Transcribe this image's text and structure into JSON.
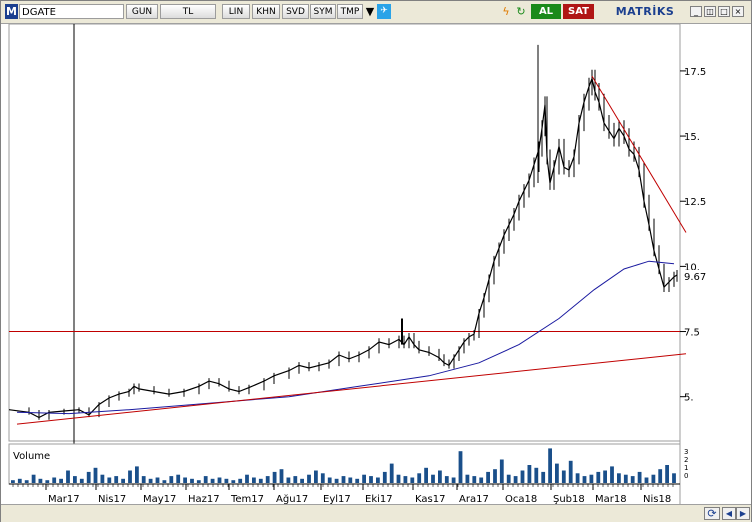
{
  "toolbar": {
    "logo": "M",
    "symbol": "DGATE",
    "period": "GUN",
    "currency": "TL",
    "buttons": [
      "LIN",
      "KHN",
      "SVD",
      "SYM",
      "TMP"
    ],
    "buy_label": "AL",
    "sell_label": "SAT",
    "brand": "MATRİKS",
    "minimize": "_",
    "restore": "◫",
    "maximize": "□",
    "close": "×"
  },
  "volume": {
    "label": "Volume",
    "mini_labels": [
      "3",
      "2",
      "1",
      "0"
    ]
  },
  "chart_data": {
    "type": "candlestick",
    "title": "",
    "ylim": [
      3.3,
      19.3
    ],
    "y_ticks": [
      "17.5",
      "15.",
      "12.5",
      "10.",
      "7.5",
      "5."
    ],
    "last_price_label": "9.67",
    "x_ticks": [
      "Mar17",
      "Nis17",
      "May17",
      "Haz17",
      "Tem17",
      "Ağu17",
      "Eyl17",
      "Eki17",
      "Kas17",
      "Ara17",
      "Oca18",
      "Şub18",
      "Mar18",
      "Nis18"
    ],
    "horizontal_line": 7.5,
    "series": [
      {
        "name": "",
        "points": [
          [
            0,
            4.5
          ],
          [
            20,
            4.4
          ],
          [
            30,
            4.2
          ],
          [
            40,
            4.4
          ],
          [
            55,
            4.45
          ],
          [
            70,
            4.5
          ],
          [
            80,
            4.3
          ],
          [
            90,
            4.7
          ],
          [
            100,
            4.95
          ],
          [
            110,
            5.1
          ],
          [
            120,
            5.2
          ],
          [
            125,
            5.4
          ],
          [
            130,
            5.3
          ],
          [
            145,
            5.2
          ],
          [
            160,
            5.1
          ],
          [
            175,
            5.2
          ],
          [
            190,
            5.4
          ],
          [
            200,
            5.6
          ],
          [
            210,
            5.5
          ],
          [
            220,
            5.3
          ],
          [
            230,
            5.2
          ],
          [
            240,
            5.35
          ],
          [
            255,
            5.6
          ],
          [
            265,
            5.8
          ],
          [
            280,
            6.0
          ],
          [
            290,
            6.2
          ],
          [
            300,
            6.1
          ],
          [
            310,
            6.2
          ],
          [
            320,
            6.3
          ],
          [
            330,
            6.6
          ],
          [
            340,
            6.45
          ],
          [
            350,
            6.6
          ],
          [
            360,
            6.8
          ],
          [
            370,
            7.1
          ],
          [
            380,
            7.0
          ],
          [
            390,
            7.2
          ],
          [
            395,
            7.0
          ],
          [
            400,
            7.3
          ],
          [
            405,
            7.0
          ],
          [
            410,
            6.8
          ],
          [
            420,
            6.7
          ],
          [
            430,
            6.5
          ],
          [
            435,
            6.3
          ],
          [
            440,
            6.2
          ],
          [
            445,
            6.5
          ],
          [
            450,
            6.8
          ],
          [
            455,
            7.1
          ],
          [
            460,
            7.3
          ],
          [
            465,
            7.4
          ],
          [
            470,
            8.2
          ],
          [
            475,
            8.8
          ],
          [
            480,
            9.5
          ],
          [
            485,
            10.2
          ],
          [
            490,
            10.7
          ],
          [
            495,
            11.2
          ],
          [
            500,
            11.6
          ],
          [
            505,
            12.0
          ],
          [
            510,
            12.5
          ],
          [
            515,
            12.9
          ],
          [
            520,
            13.3
          ],
          [
            525,
            13.9
          ],
          [
            530,
            14.5
          ],
          [
            533,
            15.3
          ],
          [
            536,
            16.2
          ],
          [
            538,
            14.2
          ],
          [
            541,
            13.2
          ],
          [
            545,
            13.8
          ],
          [
            550,
            14.6
          ],
          [
            555,
            13.8
          ],
          [
            560,
            13.7
          ],
          [
            565,
            14.2
          ],
          [
            570,
            15.5
          ],
          [
            575,
            16.3
          ],
          [
            580,
            16.9
          ],
          [
            583,
            17.2
          ],
          [
            586,
            16.7
          ],
          [
            590,
            16.3
          ],
          [
            595,
            15.5
          ],
          [
            600,
            15.2
          ],
          [
            605,
            14.9
          ],
          [
            610,
            15.3
          ],
          [
            615,
            15.0
          ],
          [
            620,
            14.5
          ],
          [
            625,
            14.3
          ],
          [
            630,
            13.7
          ],
          [
            635,
            12.5
          ],
          [
            640,
            11.6
          ],
          [
            645,
            10.6
          ],
          [
            650,
            9.9
          ],
          [
            655,
            9.2
          ],
          [
            660,
            9.4
          ],
          [
            665,
            9.6
          ],
          [
            668,
            9.67
          ]
        ]
      },
      {
        "name": "",
        "points": [
          [
            8,
            4.4
          ],
          [
            60,
            4.35
          ],
          [
            120,
            4.5
          ],
          [
            200,
            4.75
          ],
          [
            280,
            5.0
          ],
          [
            350,
            5.4
          ],
          [
            420,
            5.8
          ],
          [
            470,
            6.3
          ],
          [
            510,
            7.0
          ],
          [
            550,
            8.0
          ],
          [
            585,
            9.1
          ],
          [
            615,
            9.9
          ],
          [
            640,
            10.2
          ],
          [
            665,
            10.1
          ]
        ]
      },
      {
        "name": "",
        "points": [
          [
            8,
            3.95
          ],
          [
            677,
            6.65
          ]
        ]
      },
      {
        "name": "",
        "points": [
          [
            583,
            17.3
          ],
          [
            677,
            11.3
          ]
        ]
      }
    ],
    "volume": [
      0.2,
      0.3,
      0.2,
      0.6,
      0.3,
      0.2,
      0.4,
      0.3,
      0.9,
      0.5,
      0.3,
      0.8,
      1.1,
      0.6,
      0.4,
      0.5,
      0.3,
      0.9,
      1.2,
      0.5,
      0.3,
      0.4,
      0.2,
      0.5,
      0.6,
      0.4,
      0.3,
      0.2,
      0.5,
      0.3,
      0.4,
      0.3,
      0.2,
      0.3,
      0.6,
      0.4,
      0.3,
      0.5,
      0.8,
      1.0,
      0.4,
      0.5,
      0.3,
      0.6,
      0.9,
      0.7,
      0.4,
      0.3,
      0.5,
      0.4,
      0.3,
      0.6,
      0.5,
      0.4,
      0.8,
      1.4,
      0.6,
      0.5,
      0.4,
      0.7,
      1.1,
      0.6,
      0.9,
      0.5,
      0.4,
      2.3,
      0.6,
      0.5,
      0.4,
      0.8,
      1.0,
      1.7,
      0.6,
      0.5,
      0.9,
      1.3,
      1.1,
      0.8,
      2.5,
      1.4,
      0.9,
      1.6,
      0.7,
      0.5,
      0.6,
      0.8,
      0.9,
      1.2,
      0.7,
      0.6,
      0.5,
      0.8,
      0.4,
      0.6,
      1.0,
      1.3,
      0.7
    ]
  }
}
